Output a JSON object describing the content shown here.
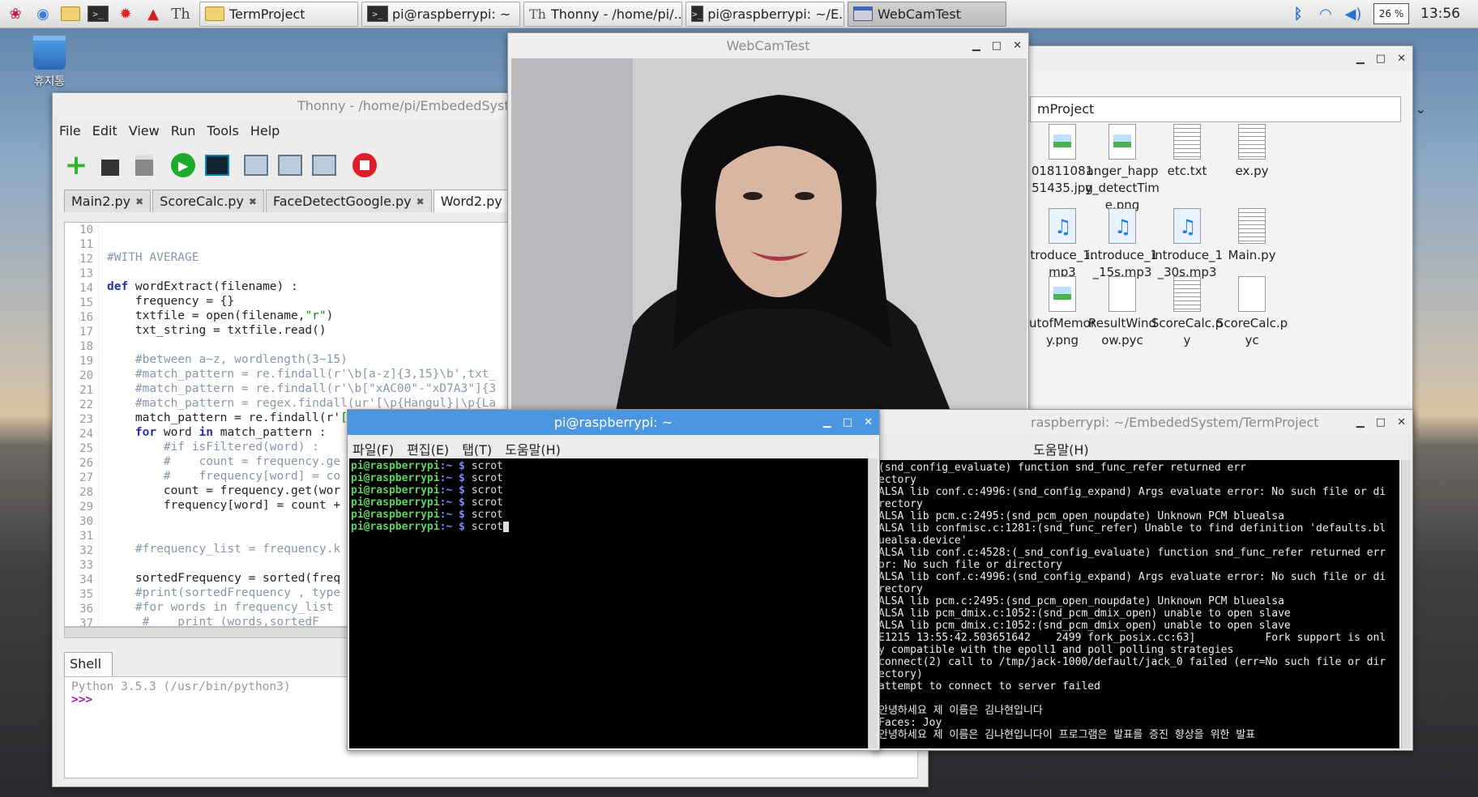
{
  "taskbar": {
    "tasks": [
      "TermProject",
      "pi@raspberrypi: ~",
      "Thonny  -  /home/pi/...",
      "pi@raspberrypi: ~/E...",
      "WebCamTest"
    ],
    "battery": "26 %",
    "clock": "13:56"
  },
  "desktop": {
    "trash_label": "휴지통"
  },
  "thonny": {
    "title": "Thonny  -  /home/pi/EmbededSystem",
    "menu": [
      "File",
      "Edit",
      "View",
      "Run",
      "Tools",
      "Help"
    ],
    "tabs": [
      "Main2.py",
      "ScoreCalc.py",
      "FaceDetectGoogle.py",
      "Word2.py"
    ],
    "line_numbers": [
      "10",
      "11",
      "12",
      "13",
      "14",
      "15",
      "16",
      "17",
      "18",
      "19",
      "20",
      "21",
      "22",
      "23",
      "24",
      "25",
      "26",
      "27",
      "28",
      "29",
      "30",
      "31",
      "32",
      "33",
      "34",
      "35",
      "36",
      "37"
    ],
    "shell_tab": "Shell",
    "shell_version": "Python 3.5.3 (/usr/bin/python3)",
    "shell_prompt": ">>>"
  },
  "webcam": {
    "title": "WebCamTest"
  },
  "files": {
    "path": "mProject",
    "items": [
      {
        "label": "01811081\n51435.jpg",
        "kind": "image"
      },
      {
        "label": "anger_happ\ny_detectTim\ne.png",
        "kind": "image"
      },
      {
        "label": "etc.txt",
        "kind": "text"
      },
      {
        "label": "ex.py",
        "kind": "text"
      },
      {
        "label": "troduce_1.\nmp3",
        "kind": "audio"
      },
      {
        "label": "introduce_1\n_15s.mp3",
        "kind": "audio"
      },
      {
        "label": "introduce_1\n_30s.mp3",
        "kind": "audio"
      },
      {
        "label": "Main.py",
        "kind": "text"
      },
      {
        "label": "utofMemor\ny.png",
        "kind": "image"
      },
      {
        "label": "ResultWind\now.pyc",
        "kind": "blank"
      },
      {
        "label": "ScoreCalc.p\ny",
        "kind": "text"
      },
      {
        "label": "ScoreCalc.p\nyc",
        "kind": "blank"
      }
    ]
  },
  "term2": {
    "title": "raspberrypi: ~/EmbededSystem/TermProject",
    "menu": "도움말(H)",
    "lines": [
      "(snd_config_evaluate) function snd_func_refer returned err",
      "ectory",
      "ALSA lib conf.c:4996:(snd_config_expand) Args evaluate error: No such file or di",
      "rectory",
      "ALSA lib pcm.c:2495:(snd_pcm_open_noupdate) Unknown PCM bluealsa",
      "ALSA lib confmisc.c:1281:(snd_func_refer) Unable to find definition 'defaults.bl",
      "uealsa.device'",
      "ALSA lib conf.c:4528:(_snd_config_evaluate) function snd_func_refer returned err",
      "or: No such file or directory",
      "ALSA lib conf.c:4996:(snd_config_expand) Args evaluate error: No such file or di",
      "rectory",
      "ALSA lib pcm.c:2495:(snd_pcm_open_noupdate) Unknown PCM bluealsa",
      "ALSA lib pcm_dmix.c:1052:(snd_pcm_dmix_open) unable to open slave",
      "ALSA lib pcm_dmix.c:1052:(snd_pcm_dmix_open) unable to open slave",
      "E1215 13:55:42.503651642    2499 fork_posix.cc:63]           Fork support is onl",
      "y compatible with the epoll1 and poll polling strategies",
      "connect(2) call to /tmp/jack-1000/default/jack_0 failed (err=No such file or dir",
      "ectory)",
      "attempt to connect to server failed",
      "",
      "안녕하세요 제 이름은 김나현입니다",
      "Faces: Joy",
      "안녕하세요 제 이름은 김나현입니다이 프로그램은 발표를 증진 향상을 위한 발표"
    ]
  },
  "term1": {
    "title": "pi@raspberrypi: ~",
    "menu": [
      "파일(F)",
      "편집(E)",
      "탭(T)",
      "도움말(H)"
    ],
    "user": "pi@raspberrypi",
    "path": ":~ $ ",
    "commands": [
      "scrot",
      "scrot",
      "scrot",
      "scrot",
      "scrot",
      "scrot"
    ]
  }
}
